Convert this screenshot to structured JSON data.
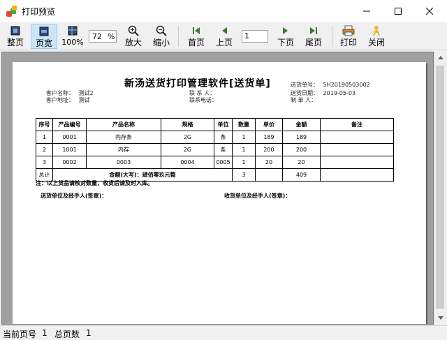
{
  "window": {
    "title": "打印预览"
  },
  "toolbar": {
    "fit_page": "整页",
    "page_width": "页宽",
    "actual_size": "100%",
    "zoom_value": "72",
    "zoom_unit": "%",
    "zoom_in": "放大",
    "zoom_out": "缩小",
    "first_page": "首页",
    "prev_page": "上页",
    "page_number": "1",
    "next_page": "下页",
    "last_page": "尾页",
    "print": "打印",
    "close": "关闭"
  },
  "document": {
    "title": "新汤送货打印管理软件[送货单]",
    "customer_name_label": "客户名称：",
    "customer_name": "测试2",
    "customer_address_label": "客户地址：",
    "customer_address": "测试",
    "contact_label": "联 系 人：",
    "contact_phone_label": "联系电话：",
    "delivery_no_label": "送货单号：",
    "delivery_no": "SH20190503002",
    "delivery_date_label": "送货日期：",
    "delivery_date": "2019-05-03",
    "maker_label": "制 单 人：",
    "columns": [
      "序号",
      "产品编号",
      "产品名称",
      "规格",
      "单位",
      "数量",
      "单价",
      "金额",
      "备注"
    ],
    "rows": [
      [
        "1",
        "0001",
        "内存条",
        "2G",
        "条",
        "1",
        "189",
        "189",
        ""
      ],
      [
        "2",
        "1001",
        "内存",
        "2G",
        "条",
        "1",
        "200",
        "200",
        ""
      ],
      [
        "3",
        "0002",
        "0003",
        "0004",
        "0005",
        "1",
        "20",
        "20",
        ""
      ]
    ],
    "total_label": "总计",
    "amount_in_words": "金额(大写)：肆佰零玖元整",
    "total_qty": "3",
    "total_amount": "409",
    "note": "注：以上货品请核对数量，收货后请及时入库。",
    "sender_sign": "送货单位及经手人(签章)：",
    "receiver_sign": "收货单位及经手人(签章)："
  },
  "status": {
    "current_page_label": "当前页号",
    "current_page": "1",
    "total_pages_label": "总页数",
    "total_pages": "1"
  }
}
